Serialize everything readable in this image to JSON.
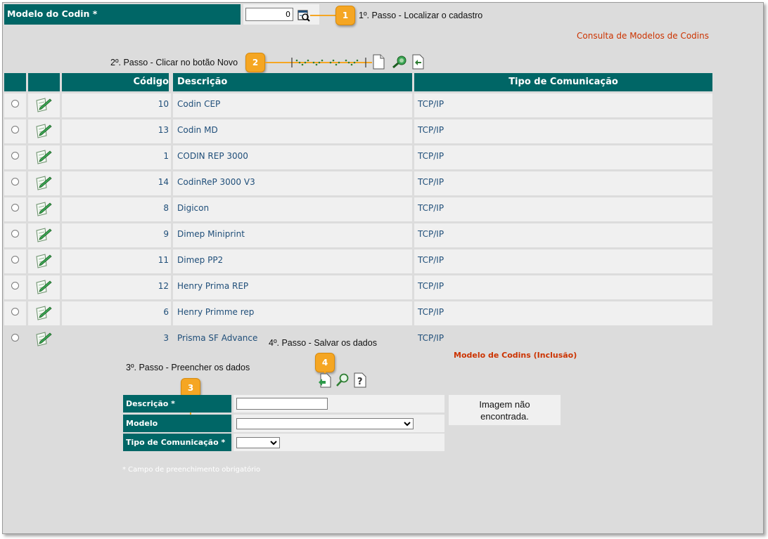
{
  "header": {
    "field_label": "Modelo do Codin *",
    "field_value": "0"
  },
  "steps": {
    "step1": "1º. Passo - Localizar o cadastro",
    "step2": "2º. Passo - Clicar no botão Novo",
    "step3": "3º. Passo - Preencher os dados",
    "step4": "4º. Passo - Salvar os dados"
  },
  "callouts": [
    "1",
    "2",
    "3",
    "4"
  ],
  "consulta_title": "Consulta de Modelos de Codins",
  "toolbar_icons": [
    "pager-dots-icon",
    "new-document-icon",
    "search-icon",
    "export-icon"
  ],
  "table": {
    "headers": {
      "codigo": "Código",
      "descricao": "Descrição",
      "tipo": "Tipo de Comunicação"
    },
    "rows": [
      {
        "codigo": "10",
        "descricao": "Codin CEP",
        "tipo": "TCP/IP"
      },
      {
        "codigo": "13",
        "descricao": "Codin MD",
        "tipo": "TCP/IP"
      },
      {
        "codigo": "1",
        "descricao": "CODIN REP 3000",
        "tipo": "TCP/IP"
      },
      {
        "codigo": "14",
        "descricao": "CodinReP 3000 V3",
        "tipo": "TCP/IP"
      },
      {
        "codigo": "8",
        "descricao": "Digicon",
        "tipo": "TCP/IP"
      },
      {
        "codigo": "9",
        "descricao": "Dimep Miniprint",
        "tipo": "TCP/IP"
      },
      {
        "codigo": "11",
        "descricao": "Dimep PP2",
        "tipo": "TCP/IP"
      },
      {
        "codigo": "12",
        "descricao": "Henry Prima REP",
        "tipo": "TCP/IP"
      },
      {
        "codigo": "6",
        "descricao": "Henry Primme rep",
        "tipo": "TCP/IP"
      },
      {
        "codigo": "3",
        "descricao": "Prisma SF Advance",
        "tipo": "TCP/IP"
      }
    ]
  },
  "form": {
    "title": "Modelo de Codins (Inclusão)",
    "fields": {
      "descricao_label": "Descrição *",
      "modelo_label": "Modelo",
      "tipo_label": "Tipo de Comunicação *"
    },
    "image_placeholder_line1": "Imagem não",
    "image_placeholder_line2": "encontrada.",
    "footnote": "* Campo de preenchimento obrigatório"
  },
  "colors": {
    "header_teal": "#006666",
    "accent_red": "#cc3300",
    "callout_orange": "#f5a623",
    "link_blue": "#1f4e79"
  }
}
